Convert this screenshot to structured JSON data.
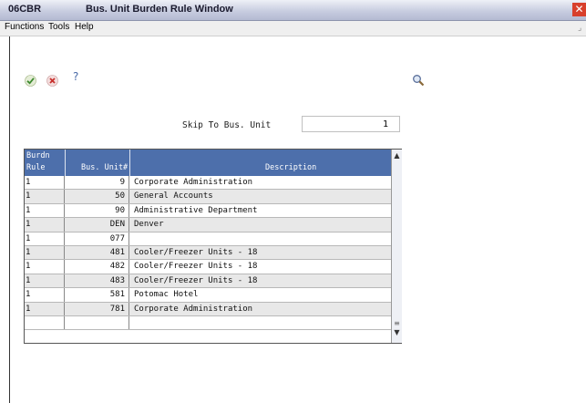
{
  "window": {
    "id": "06CBR",
    "title": "Bus. Unit Burden Rule Window",
    "close_glyph": "✕"
  },
  "menu": [
    "Functions",
    "Tools",
    "Help"
  ],
  "toolbar": {
    "ok_icon": "check-icon",
    "cancel_icon": "x-icon",
    "help_glyph": "?",
    "search_icon": "magnifier-icon"
  },
  "skip": {
    "label": "Skip To Bus. Unit",
    "value": "1"
  },
  "grid": {
    "header_color": "#4d6fab",
    "columns": {
      "rule_line1": "Burdn",
      "rule_line2": "Rule",
      "unit": "Bus. Unit#",
      "desc": "Description"
    },
    "rows": [
      {
        "rule": "1",
        "unit": "9",
        "desc": "Corporate Administration"
      },
      {
        "rule": "1",
        "unit": "50",
        "desc": "General Accounts"
      },
      {
        "rule": "1",
        "unit": "90",
        "desc": "Administrative Department"
      },
      {
        "rule": "1",
        "unit": "DEN",
        "desc": "Denver"
      },
      {
        "rule": "1",
        "unit": "077",
        "desc": ""
      },
      {
        "rule": "1",
        "unit": "481",
        "desc": "Cooler/Freezer Units - 18"
      },
      {
        "rule": "1",
        "unit": "482",
        "desc": "Cooler/Freezer Units - 18"
      },
      {
        "rule": "1",
        "unit": "483",
        "desc": "Cooler/Freezer Units - 18"
      },
      {
        "rule": "1",
        "unit": "581",
        "desc": "Potomac Hotel"
      },
      {
        "rule": "1",
        "unit": "781",
        "desc": "Corporate Administration"
      },
      {
        "rule": "",
        "unit": "",
        "desc": ""
      }
    ]
  }
}
